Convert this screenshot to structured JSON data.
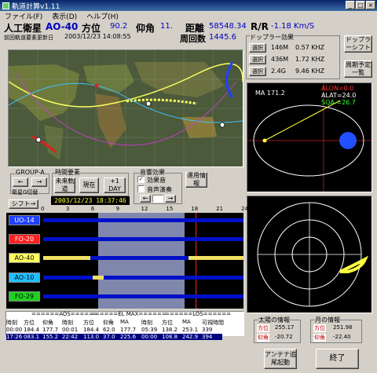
{
  "window": {
    "title": "軌道計算v1.11",
    "btn_min": "_",
    "btn_max": "□",
    "btn_close": "×"
  },
  "menu": [
    "ファイル(F)",
    "表示(D)",
    "ヘルプ(H)"
  ],
  "header": {
    "sat_label": "人工衛星",
    "sat_name": "AO-40",
    "az_label": "方位",
    "az_value": "90.2",
    "el_label": "仰角",
    "el_value": "11.",
    "dist_label": "距離",
    "dist_value": "58548.34",
    "rr_label": "R/R",
    "rr_value": "-1.18 Km/S",
    "update_label": "前回軌道要素更新日",
    "update_value": "2003/12/23 14:08:55",
    "orbit_label": "周回数",
    "orbit_value": "1445.6"
  },
  "doppler": {
    "title": "ドップラー効果",
    "rows": [
      {
        "btn": "選択",
        "freq": "146M",
        "shift": "0.57 KHZ"
      },
      {
        "btn": "選択",
        "freq": "436M",
        "shift": "1.72 KHZ"
      },
      {
        "btn": "選択",
        "freq": "2.4G",
        "shift": "9.46 KHZ"
      }
    ],
    "btn_doppler_shift": "ドップラーシフト",
    "btn_period_list": "周期予定一覧"
  },
  "orbit_view": {
    "alon": "ALON=0.0",
    "alat": "ALAT=24.0",
    "sqa": "SQA =26.7",
    "ma": "MA 171.2"
  },
  "controls": {
    "group_label": "GROUP-A",
    "left": "←",
    "right": "→",
    "group_select": "衛星G切替",
    "time_label": "時間要素",
    "btn_future": "未来軌道",
    "btn_now": "現在",
    "btn_plus_day": "+1 DAY",
    "sound_label": "音響効果",
    "sound_effect": "効果音",
    "sound_dictation": "音声演奏",
    "btn_ops": "運用情報",
    "datetime": "2003/12/23 18:37:46",
    "arrow_left": "←",
    "arrow_right": "→",
    "shift_btn": "シフト→"
  },
  "timeline": {
    "hours": [
      "0",
      "3",
      "6",
      "9",
      "12",
      "15",
      "18",
      "21",
      "24"
    ],
    "sats": [
      {
        "name": "UO-14",
        "color": "#2040ff",
        "text": "#ffffff"
      },
      {
        "name": "FO-20",
        "color": "#ff2020",
        "text": "#ffffff"
      },
      {
        "name": "AO-40",
        "color": "#ffff60",
        "text": "#000000"
      },
      {
        "name": "AO-10",
        "color": "#20c0ff",
        "text": "#000000"
      },
      {
        "name": "FO-29",
        "color": "#20d020",
        "text": "#000000"
      }
    ]
  },
  "table": {
    "group_headers": [
      "======AOS======",
      "======EL MAX======",
      "======LOS======"
    ],
    "columns": [
      "時刻",
      "方位",
      "仰角",
      "時刻",
      "方位",
      "仰角",
      "MA",
      "時刻",
      "方位",
      "MA",
      "可視時間"
    ],
    "rows": [
      [
        "00:00",
        "184.4",
        "177.7",
        "00:01",
        "184.4",
        "62.0",
        "177.7",
        "05:39",
        "138.2",
        "253.1",
        "339"
      ],
      [
        "17:26",
        "083.1",
        "155.2",
        "22:42",
        "113.0",
        "37.0",
        "225.6",
        "00:00",
        "108.8",
        "242.9",
        "394"
      ]
    ]
  },
  "sun_info": {
    "title": "太陽の情報",
    "az_label": "方位",
    "az": "255.17",
    "el_label": "仰角",
    "el": "-20.72"
  },
  "moon_info": {
    "title": "月の情報",
    "az_label": "方位",
    "az": "251.98",
    "el_label": "仰角",
    "el": "-22.40"
  },
  "buttons": {
    "antenna": "アンテナ追尾起動",
    "exit": "終了"
  },
  "colors": {
    "title_bar": "#0a246a",
    "accent_blue": "#0000c0",
    "track_bar": "#0010c8",
    "pass_segment": "#f0e060"
  }
}
